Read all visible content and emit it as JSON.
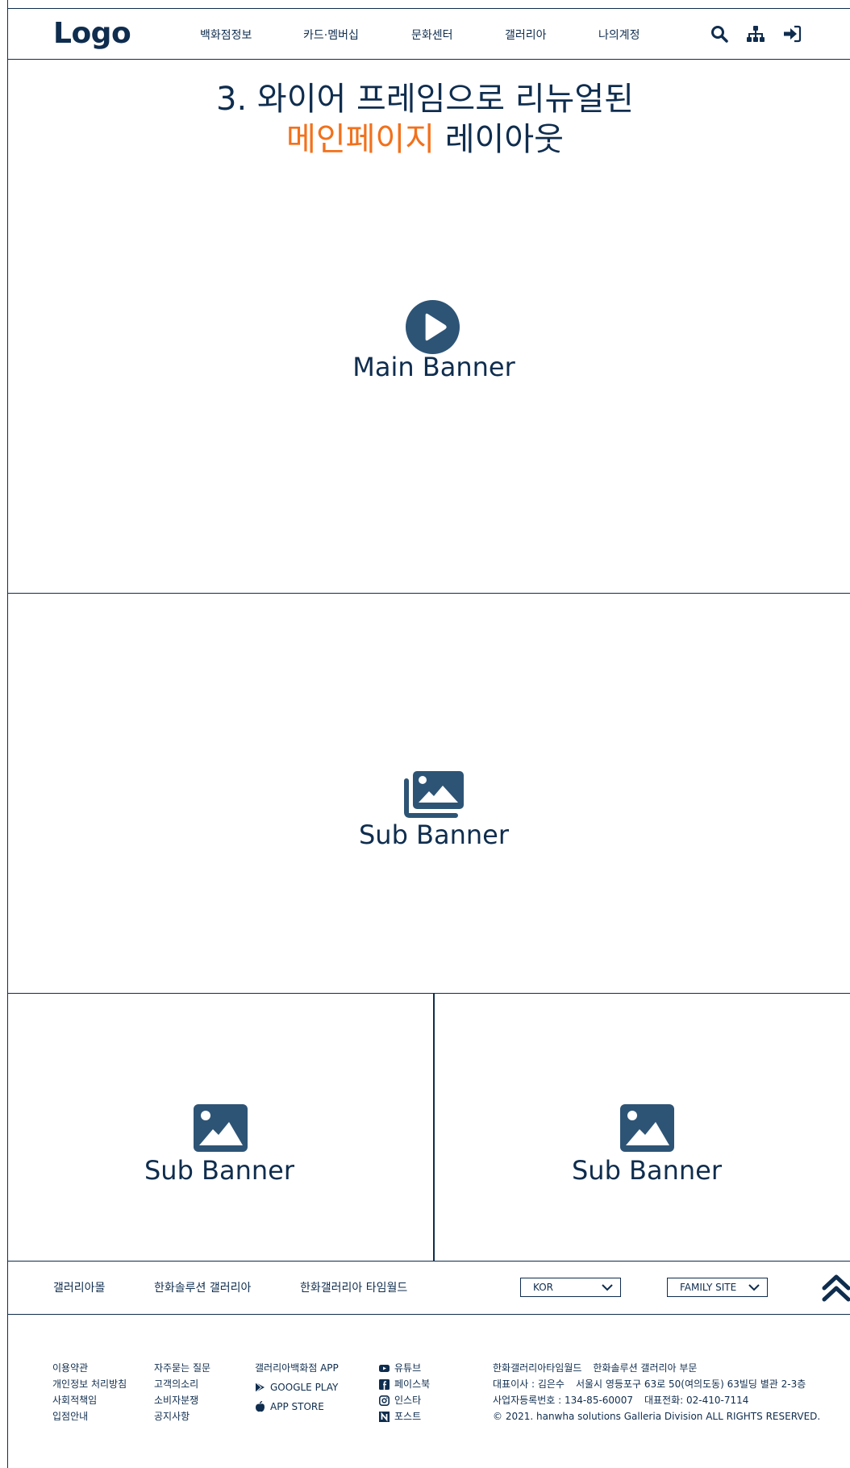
{
  "header": {
    "logo": "Logo",
    "nav": [
      "백화점정보",
      "카드·멤버십",
      "문화센터",
      "갤러리아",
      "나의계정"
    ]
  },
  "main_banner": {
    "headline_line1": "3. 와이어 프레임으로 리뉴얼된",
    "headline_accent": "메인페이지",
    "headline_rest": " 레이아웃",
    "label": "Main Banner"
  },
  "sub_banners": [
    "Sub Banner",
    "Sub Banner",
    "Sub Banner"
  ],
  "link_bar": {
    "links": [
      "갤러리아몰",
      "한화솔루션 갤러리아",
      "한화갤러리아 타임월드"
    ],
    "language": "KOR",
    "family_site": "FAMILY SITE"
  },
  "footer": {
    "col1": [
      "이용약관",
      "개인정보 처리방침",
      "사회적책임",
      "입점안내"
    ],
    "col2": [
      "자주묻는 질문",
      "고객의소리",
      "소비자분쟁",
      "공지사항"
    ],
    "app": {
      "title": "갤러리아백화점 APP",
      "google": "GOOGLE PLAY",
      "apple": "APP STORE"
    },
    "social": [
      "유튜브",
      "페이스북",
      "인스타",
      "포스트"
    ],
    "company": {
      "names": [
        "한화갤러리아타임월드",
        "한화솔루션 갤러리아 부문"
      ],
      "ceo": "대표이사 : 김은수",
      "address": "서울시 영등포구 63로 50(여의도동) 63빌딩 별관 2-3층",
      "business_no": "사업자등록번호 : 134-85-60007",
      "phone": "대표전화: 02-410-7114",
      "copyright": "© 2021. hanwha solutions Galleria Division ALL RIGHTS RESERVED."
    }
  },
  "colors": {
    "primary": "#0f2d4e",
    "icon": "#2d5475",
    "accent": "#f2711c"
  }
}
